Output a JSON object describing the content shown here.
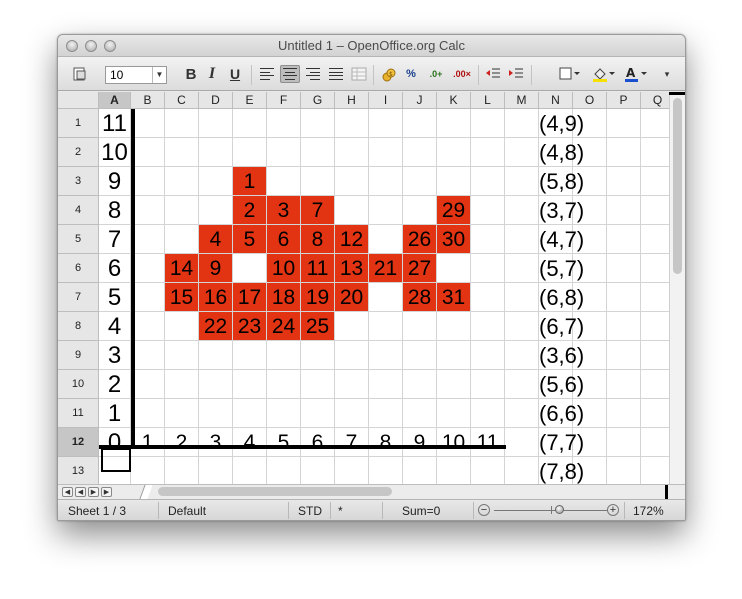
{
  "window": {
    "title": "Untitled 1 – OpenOffice.org Calc"
  },
  "toolbar": {
    "font_size": "10",
    "bold_label": "B",
    "italic_label": "I",
    "underline_label": "U",
    "icons": [
      "styles-icon",
      "align-left-icon",
      "align-center-icon",
      "align-right-icon",
      "justify-icon",
      "merge-cells-icon",
      "currency-icon",
      "percent-icon",
      "add-decimal-icon",
      "delete-decimal-icon",
      "decrease-indent-icon",
      "increase-indent-icon",
      "borders-icon",
      "background-color-icon",
      "font-color-icon"
    ]
  },
  "sheet": {
    "columns": [
      "A",
      "B",
      "C",
      "D",
      "E",
      "F",
      "G",
      "H",
      "I",
      "J",
      "K",
      "L",
      "M",
      "N",
      "O",
      "P",
      "Q"
    ],
    "rows": [
      "1",
      "2",
      "3",
      "4",
      "5",
      "6",
      "7",
      "8",
      "9",
      "10",
      "11",
      "12",
      "13"
    ],
    "active_column": "A",
    "active_row": "12",
    "highlight_color": "#e23413",
    "column_a_values": [
      "11",
      "10",
      "9",
      "8",
      "7",
      "6",
      "5",
      "4",
      "3",
      "2",
      "1",
      "0",
      ""
    ],
    "row_12_values": [
      "0",
      "1",
      "2",
      "3",
      "4",
      "5",
      "6",
      "7",
      "8",
      "9",
      "10",
      "11"
    ],
    "column_n_values": [
      "(4,9)",
      "(4,8)",
      "(5,8)",
      "(3,7)",
      "(4,7)",
      "(5,7)",
      "(6,8)",
      "(6,7)",
      "(3,6)",
      "(5,6)",
      "(6,6)",
      "(7,7)",
      "(7,8)"
    ],
    "red_cells": [
      {
        "row": 3,
        "col": "E",
        "value": "1"
      },
      {
        "row": 4,
        "col": "E",
        "value": "2"
      },
      {
        "row": 4,
        "col": "F",
        "value": "3"
      },
      {
        "row": 4,
        "col": "G",
        "value": "7"
      },
      {
        "row": 4,
        "col": "K",
        "value": "29"
      },
      {
        "row": 5,
        "col": "D",
        "value": "4"
      },
      {
        "row": 5,
        "col": "E",
        "value": "5"
      },
      {
        "row": 5,
        "col": "F",
        "value": "6"
      },
      {
        "row": 5,
        "col": "G",
        "value": "8"
      },
      {
        "row": 5,
        "col": "H",
        "value": "12"
      },
      {
        "row": 5,
        "col": "J",
        "value": "26"
      },
      {
        "row": 5,
        "col": "K",
        "value": "30"
      },
      {
        "row": 6,
        "col": "C",
        "value": "14"
      },
      {
        "row": 6,
        "col": "D",
        "value": "9"
      },
      {
        "row": 6,
        "col": "F",
        "value": "10"
      },
      {
        "row": 6,
        "col": "G",
        "value": "11"
      },
      {
        "row": 6,
        "col": "H",
        "value": "13"
      },
      {
        "row": 6,
        "col": "I",
        "value": "21"
      },
      {
        "row": 6,
        "col": "J",
        "value": "27"
      },
      {
        "row": 7,
        "col": "C",
        "value": "15"
      },
      {
        "row": 7,
        "col": "D",
        "value": "16"
      },
      {
        "row": 7,
        "col": "E",
        "value": "17"
      },
      {
        "row": 7,
        "col": "F",
        "value": "18"
      },
      {
        "row": 7,
        "col": "G",
        "value": "19"
      },
      {
        "row": 7,
        "col": "H",
        "value": "20"
      },
      {
        "row": 7,
        "col": "J",
        "value": "28"
      },
      {
        "row": 7,
        "col": "K",
        "value": "31"
      },
      {
        "row": 8,
        "col": "D",
        "value": "22"
      },
      {
        "row": 8,
        "col": "E",
        "value": "23"
      },
      {
        "row": 8,
        "col": "F",
        "value": "24"
      },
      {
        "row": 8,
        "col": "G",
        "value": "25"
      }
    ]
  },
  "status": {
    "sheet": "Sheet 1 / 3",
    "style": "Default",
    "mode": "STD",
    "modified": "*",
    "sum": "Sum=0",
    "zoom": "172%"
  }
}
